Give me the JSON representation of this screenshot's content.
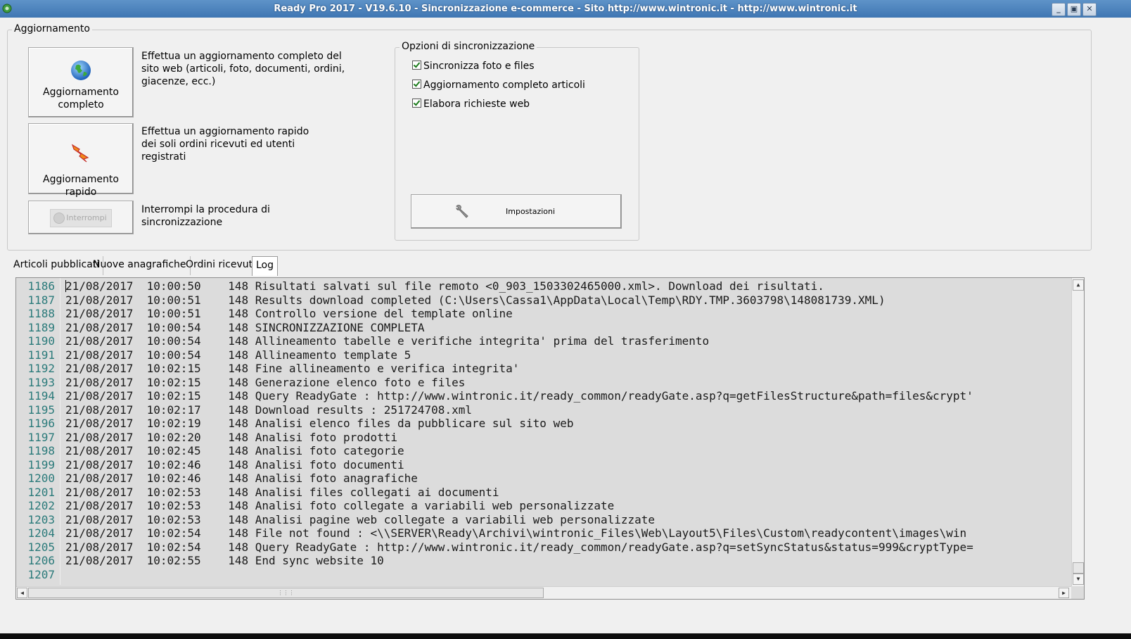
{
  "window": {
    "title": "Ready Pro 2017 - V19.6.10 - Sincronizzazione e-commerce - Sito http://www.wintronic.it - http://www.wintronic.it"
  },
  "update_group": {
    "legend": "Aggiornamento",
    "full_button_label": "Aggiornamento completo",
    "full_description": "Effettua un aggiornamento completo del sito web (articoli, foto, documenti, ordini, giacenze, ecc.)",
    "quick_button_label": "Aggiornamento rapido",
    "quick_description": "Effettua un aggiornamento rapido dei soli ordini ricevuti ed utenti registrati",
    "stop_button_label": "Interrompi",
    "stop_description": "Interrompi la procedura di sincronizzazione"
  },
  "sync_options": {
    "legend": "Opzioni di sincronizzazione",
    "options": [
      {
        "label": "Sincronizza foto e files",
        "checked": true
      },
      {
        "label": "Aggiornamento completo articoli",
        "checked": true
      },
      {
        "label": "Elabora richieste web",
        "checked": true
      }
    ],
    "settings_button_label": "Impostazioni"
  },
  "tabs": [
    {
      "label": "Articoli pubblicati",
      "active": false
    },
    {
      "label": "Nuove anagrafiche",
      "active": false
    },
    {
      "label": "Ordini ricevuti",
      "active": false
    },
    {
      "label": "Log",
      "active": true
    }
  ],
  "log": {
    "lines": [
      {
        "n": "1186",
        "text": "21/08/2017  10:00:50    148 Risultati salvati sul file remoto <0_903_1503302465000.xml>. Download dei risultati."
      },
      {
        "n": "1187",
        "text": "21/08/2017  10:00:51    148 Results download completed (C:\\Users\\Cassa1\\AppData\\Local\\Temp\\RDY.TMP.3603798\\148081739.XML)"
      },
      {
        "n": "1188",
        "text": "21/08/2017  10:00:51    148 Controllo versione del template online"
      },
      {
        "n": "1189",
        "text": "21/08/2017  10:00:54    148 SINCRONIZZAZIONE COMPLETA"
      },
      {
        "n": "1190",
        "text": "21/08/2017  10:00:54    148 Allineamento tabelle e verifiche integrita' prima del trasferimento"
      },
      {
        "n": "1191",
        "text": "21/08/2017  10:00:54    148 Allineamento template 5"
      },
      {
        "n": "1192",
        "text": "21/08/2017  10:02:15    148 Fine allineamento e verifica integrita'"
      },
      {
        "n": "1193",
        "text": "21/08/2017  10:02:15    148 Generazione elenco foto e files"
      },
      {
        "n": "1194",
        "text": "21/08/2017  10:02:15    148 Query ReadyGate : http://www.wintronic.it/ready_common/readyGate.asp?q=getFilesStructure&path=files&crypt'"
      },
      {
        "n": "1195",
        "text": "21/08/2017  10:02:17    148 Download results : 251724708.xml"
      },
      {
        "n": "1196",
        "text": "21/08/2017  10:02:19    148 Analisi elenco files da pubblicare sul sito web"
      },
      {
        "n": "1197",
        "text": "21/08/2017  10:02:20    148 Analisi foto prodotti"
      },
      {
        "n": "1198",
        "text": "21/08/2017  10:02:45    148 Analisi foto categorie"
      },
      {
        "n": "1199",
        "text": "21/08/2017  10:02:46    148 Analisi foto documenti"
      },
      {
        "n": "1200",
        "text": "21/08/2017  10:02:46    148 Analisi foto anagrafiche"
      },
      {
        "n": "1201",
        "text": "21/08/2017  10:02:53    148 Analisi files collegati ai documenti"
      },
      {
        "n": "1202",
        "text": "21/08/2017  10:02:53    148 Analisi foto collegate a variabili web personalizzate"
      },
      {
        "n": "1203",
        "text": "21/08/2017  10:02:53    148 Analisi pagine web collegate a variabili web personalizzate"
      },
      {
        "n": "1204",
        "text": "21/08/2017  10:02:54    148 File not found : <\\\\SERVER\\Ready\\Archivi\\wintronic_Files\\Web\\Layout5\\Files\\Custom\\readycontent\\images\\win"
      },
      {
        "n": "1205",
        "text": "21/08/2017  10:02:54    148 Query ReadyGate : http://www.wintronic.it/ready_common/readyGate.asp?q=setSyncStatus&status=999&cryptType="
      },
      {
        "n": "1206",
        "text": "21/08/2017  10:02:55    148 End sync website 10"
      },
      {
        "n": "1207",
        "text": ""
      }
    ]
  }
}
